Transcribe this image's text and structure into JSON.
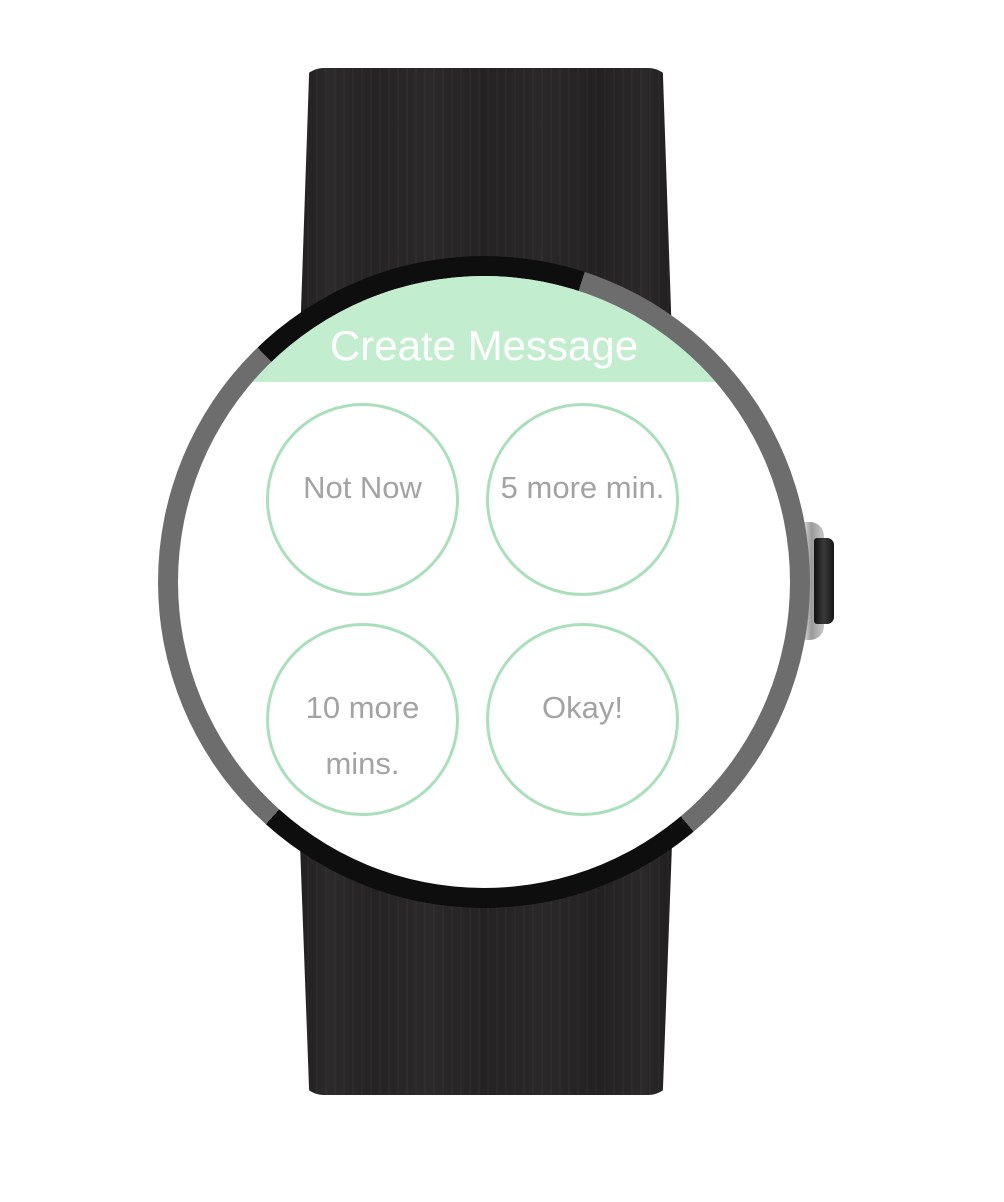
{
  "screen": {
    "title": "Create Message",
    "header_color": "#c2eecf",
    "accent_ring_color": "#aadfbb",
    "reply_text_color": "#a3a3a3"
  },
  "replies": [
    {
      "label": "Not Now"
    },
    {
      "label": "5 more min."
    },
    {
      "label": "10 more mins."
    },
    {
      "label": "Okay!"
    }
  ],
  "device": {
    "type": "round-smartwatch",
    "strap_color": "#262424",
    "crown": "side-button"
  }
}
